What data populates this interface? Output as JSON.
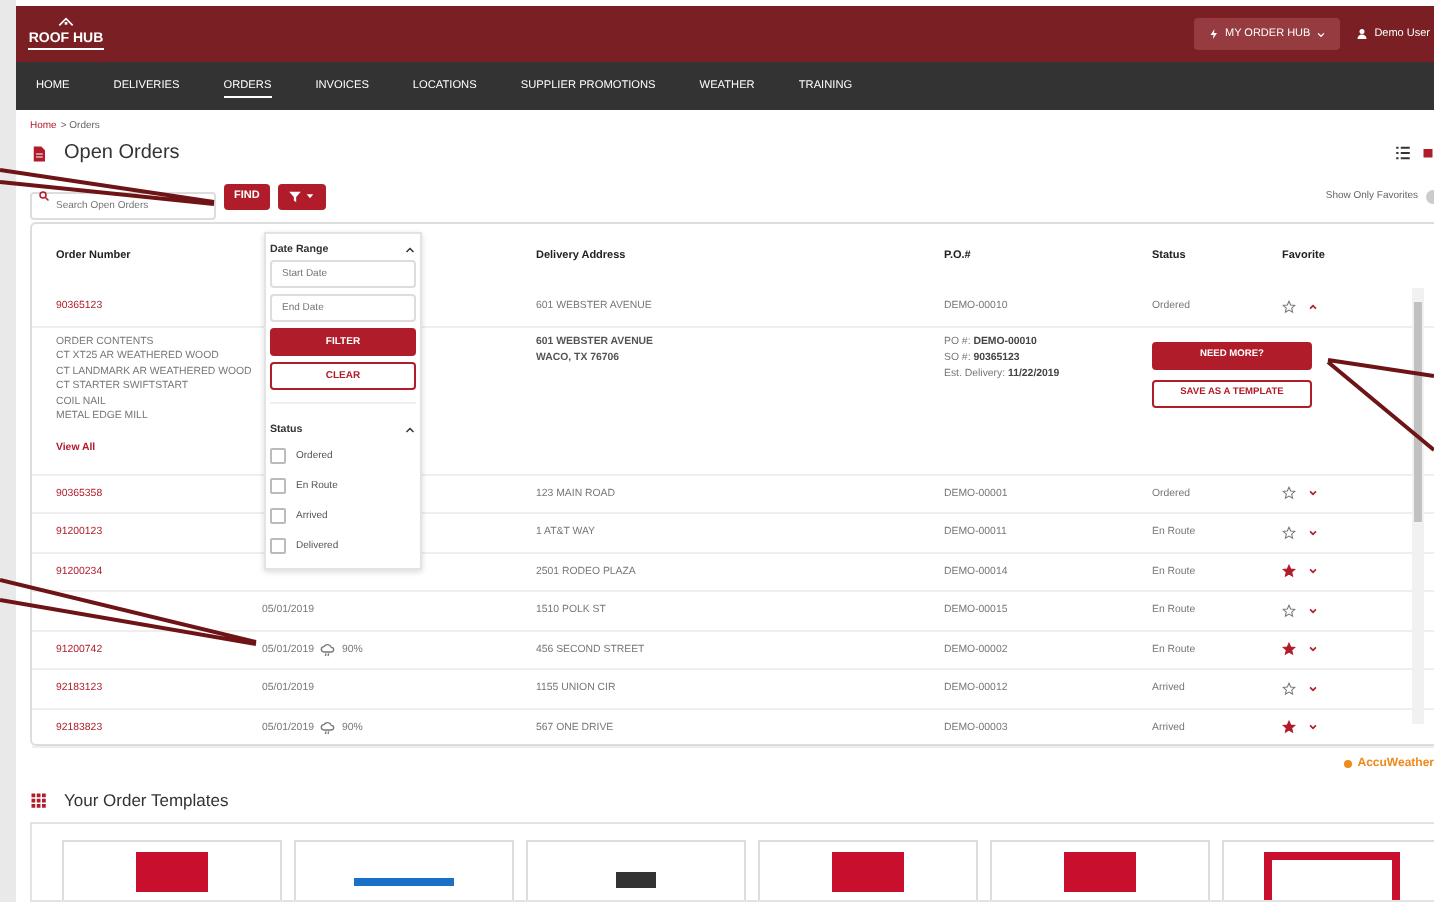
{
  "header": {
    "logo_text": "ROOF HUB",
    "hub_button": "MY ORDER HUB",
    "user": "Demo User"
  },
  "nav": [
    {
      "label": "HOME",
      "selected": false
    },
    {
      "label": "DELIVERIES",
      "selected": false
    },
    {
      "label": "ORDERS",
      "selected": true
    },
    {
      "label": "INVOICES",
      "selected": false
    },
    {
      "label": "LOCATIONS",
      "selected": false
    },
    {
      "label": "SUPPLIER PROMOTIONS",
      "selected": false
    },
    {
      "label": "WEATHER",
      "selected": false
    },
    {
      "label": "TRAINING",
      "selected": false
    }
  ],
  "breadcrumb": {
    "link": "Home",
    "current": "> Orders"
  },
  "page_title": "Open Orders",
  "search": {
    "placeholder": "Search Open Orders",
    "button": "FIND"
  },
  "favorites_toggle": {
    "label": "Show Only Favorites",
    "on": false
  },
  "table": {
    "columns": [
      "Order Number",
      "Delivery Address",
      "P.O.#",
      "Status",
      "Favorite"
    ],
    "rows": [
      {
        "order": "90365123",
        "address": "601 WEBSTER AVENUE",
        "po": "DEMO-00010",
        "status": "Ordered",
        "favorite": false,
        "expanded": true
      },
      {
        "order": "90365358",
        "address": "123 MAIN ROAD",
        "po": "DEMO-00001",
        "status": "Ordered",
        "favorite": false,
        "expanded": false
      },
      {
        "order": "91200123",
        "address": "1 AT&T WAY",
        "po": "DEMO-00011",
        "status": "En Route",
        "favorite": false,
        "expanded": false
      },
      {
        "order": "91200234",
        "address": "2501 RODEO PLAZA",
        "po": "DEMO-00014",
        "status": "En Route",
        "favorite": true,
        "expanded": false
      },
      {
        "date": "05/01/2019",
        "address": "1510 POLK ST",
        "po": "DEMO-00015",
        "status": "En Route",
        "favorite": false,
        "expanded": false
      },
      {
        "order": "91200742",
        "date": "05/01/2019",
        "weather": "90%",
        "address": "456 SECOND STREET",
        "po": "DEMO-00002",
        "status": "En Route",
        "favorite": true,
        "expanded": false
      },
      {
        "order": "92183123",
        "date": "05/01/2019",
        "address": "1155 UNION CIR",
        "po": "DEMO-00012",
        "status": "Arrived",
        "favorite": false,
        "expanded": false
      },
      {
        "order": "92183823",
        "date": "05/01/2019",
        "weather": "90%",
        "address": "567 ONE DRIVE",
        "po": "DEMO-00003",
        "status": "Arrived",
        "favorite": true,
        "expanded": false
      }
    ],
    "detail": {
      "contents_title": "ORDER CONTENTS",
      "contents": [
        "CT XT25 AR WEATHERED WOOD",
        "CT LANDMARK AR WEATHERED WOOD",
        "CT STARTER SWIFTSTART",
        "COIL NAIL",
        "METAL EDGE MILL"
      ],
      "view_all": "View All",
      "address_lines": [
        "601 WEBSTER AVENUE",
        "WACO, TX 76706"
      ],
      "info": [
        {
          "label": "PO #:",
          "value": "DEMO-00010"
        },
        {
          "label": "SO #:",
          "value": "90365123"
        },
        {
          "label": "Est. Delivery:",
          "value": "11/22/2019"
        }
      ],
      "buttons": [
        "NEED MORE?",
        "SAVE AS A TEMPLATE"
      ]
    }
  },
  "filter_menu": {
    "sections": [
      {
        "kind": "dates",
        "title": "Date Range",
        "expanded": true,
        "placeholders": [
          "Start Date",
          "End Date"
        ],
        "buttons": [
          "FILTER",
          "CLEAR"
        ]
      },
      {
        "kind": "checks",
        "title": "Status",
        "expanded": true,
        "options": [
          {
            "label": "Ordered",
            "checked": false
          },
          {
            "label": "En Route",
            "checked": false
          },
          {
            "label": "Arrived",
            "checked": false
          },
          {
            "label": "Delivered",
            "checked": false
          }
        ]
      }
    ]
  },
  "weather_credit": "AccuWeather",
  "templates": {
    "title": "Your Order Templates"
  }
}
